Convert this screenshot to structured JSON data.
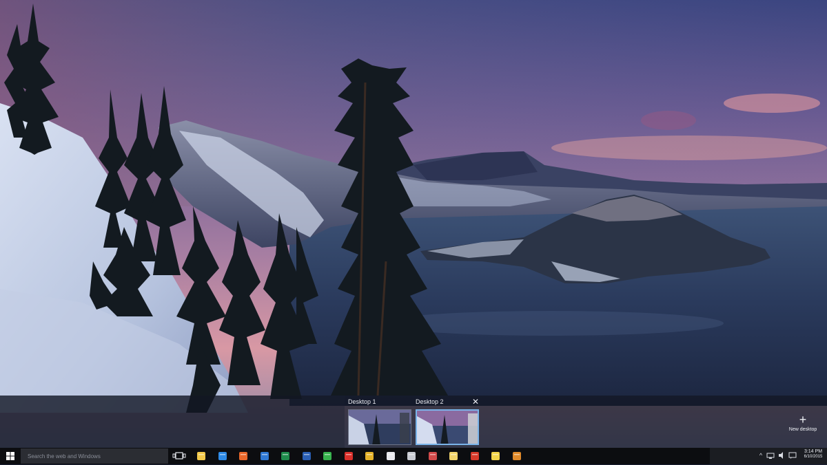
{
  "wallpaper": {
    "sky_top": "#3f4a86",
    "sky_mid": "#8c6a98",
    "horizon_glow": "#e9a0a8",
    "lake": "#2c3b5c",
    "snow": "#c8d2e8"
  },
  "task_view": {
    "desktops": [
      {
        "label": "Desktop 1",
        "active": false
      },
      {
        "label": "Desktop 2",
        "active": true
      }
    ],
    "close_glyph": "✕",
    "new_desktop": {
      "glyph": "+",
      "label": "New desktop"
    }
  },
  "taskbar": {
    "start_icon": "windows-logo-icon",
    "search_placeholder": "Search the web and Windows",
    "pinned_apps": [
      {
        "name": "file-explorer-icon",
        "color": "#f3c94b"
      },
      {
        "name": "edge-icon",
        "color": "#2e8ae6"
      },
      {
        "name": "firefox-icon",
        "color": "#e8672a"
      },
      {
        "name": "store-icon",
        "color": "#2f78d4"
      },
      {
        "name": "excel-icon",
        "color": "#1f8b4c"
      },
      {
        "name": "word-icon",
        "color": "#2b5fb4"
      },
      {
        "name": "phone-icon",
        "color": "#37b24d"
      },
      {
        "name": "acrobat-icon",
        "color": "#d9302b"
      },
      {
        "name": "chrome-icon",
        "color": "#e6b32b"
      },
      {
        "name": "photos-icon",
        "color": "#e9e9ee"
      },
      {
        "name": "calculator-icon",
        "color": "#c9ccd3"
      },
      {
        "name": "paint-icon",
        "color": "#d24a4a"
      },
      {
        "name": "folder-icon",
        "color": "#f1d36b"
      },
      {
        "name": "paint-brush-icon",
        "color": "#d63a2a"
      },
      {
        "name": "sticky-notes-icon",
        "color": "#f3d54a"
      },
      {
        "name": "media-icon",
        "color": "#e08a2b"
      }
    ],
    "tray": {
      "chevron": "^",
      "icons": [
        "network-icon",
        "volume-icon",
        "message-icon"
      ],
      "time": "3:14 PM",
      "date": "6/10/2015"
    }
  }
}
